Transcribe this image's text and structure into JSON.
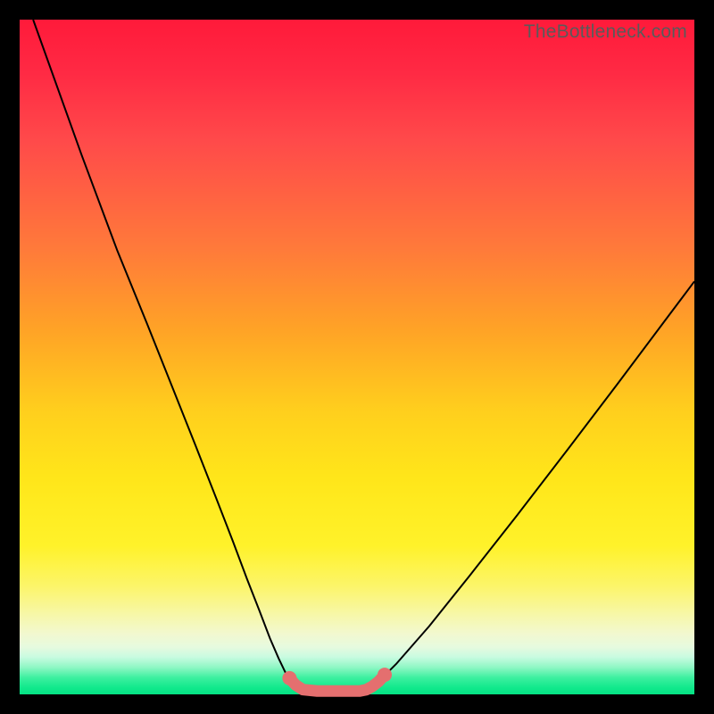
{
  "watermark": "TheBottleneck.com",
  "colors": {
    "frame": "#000000",
    "curve_stroke": "#000000",
    "pink_segment_stroke": "#e46f6f",
    "pink_dot_fill": "#e46f6f"
  },
  "chart_data": {
    "type": "line",
    "title": "",
    "xlabel": "",
    "ylabel": "",
    "xlim": [
      0,
      100
    ],
    "ylim": [
      0,
      100
    ],
    "curve": [
      {
        "x": 2.0,
        "y": 100.0
      },
      {
        "x": 9.2,
        "y": 79.9
      },
      {
        "x": 14.5,
        "y": 65.7
      },
      {
        "x": 18.9,
        "y": 54.9
      },
      {
        "x": 22.8,
        "y": 45.1
      },
      {
        "x": 26.1,
        "y": 36.8
      },
      {
        "x": 29.2,
        "y": 28.9
      },
      {
        "x": 31.6,
        "y": 22.7
      },
      {
        "x": 33.7,
        "y": 17.1
      },
      {
        "x": 35.5,
        "y": 12.5
      },
      {
        "x": 37.1,
        "y": 8.3
      },
      {
        "x": 38.4,
        "y": 5.3
      },
      {
        "x": 39.6,
        "y": 2.8
      },
      {
        "x": 40.8,
        "y": 1.3
      },
      {
        "x": 42.0,
        "y": 0.7
      },
      {
        "x": 44.1,
        "y": 0.5
      },
      {
        "x": 46.2,
        "y": 0.5
      },
      {
        "x": 48.3,
        "y": 0.5
      },
      {
        "x": 50.4,
        "y": 0.5
      },
      {
        "x": 51.6,
        "y": 0.7
      },
      {
        "x": 52.9,
        "y": 1.6
      },
      {
        "x": 55.8,
        "y": 4.5
      },
      {
        "x": 60.7,
        "y": 10.1
      },
      {
        "x": 66.7,
        "y": 17.6
      },
      {
        "x": 73.7,
        "y": 26.5
      },
      {
        "x": 81.0,
        "y": 36.0
      },
      {
        "x": 88.6,
        "y": 46.0
      },
      {
        "x": 95.8,
        "y": 55.6
      },
      {
        "x": 100.0,
        "y": 61.2
      }
    ],
    "highlight_segment": [
      {
        "x": 40.0,
        "y": 2.4
      },
      {
        "x": 40.9,
        "y": 1.4
      },
      {
        "x": 42.0,
        "y": 0.7
      },
      {
        "x": 44.1,
        "y": 0.5
      },
      {
        "x": 46.2,
        "y": 0.5
      },
      {
        "x": 48.3,
        "y": 0.5
      },
      {
        "x": 50.4,
        "y": 0.5
      },
      {
        "x": 51.4,
        "y": 0.7
      },
      {
        "x": 52.3,
        "y": 1.2
      },
      {
        "x": 53.2,
        "y": 1.9
      },
      {
        "x": 54.1,
        "y": 2.9
      }
    ],
    "highlight_dots": [
      {
        "x": 40.0,
        "y": 2.4
      },
      {
        "x": 54.1,
        "y": 2.9
      }
    ]
  }
}
